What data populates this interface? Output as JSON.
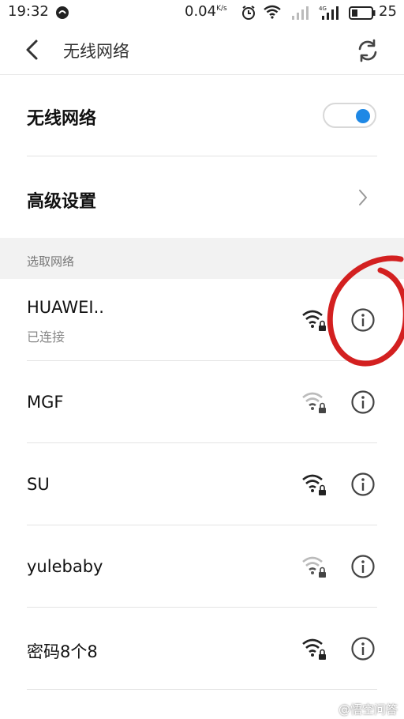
{
  "status_bar": {
    "time": "19:32",
    "speed_value": "0.04",
    "speed_unit": "K/s",
    "network_tag": "4G",
    "battery": "25"
  },
  "header": {
    "title": "无线网络"
  },
  "settings": {
    "wifi_label": "无线网络",
    "wifi_enabled": true,
    "advanced_label": "高级设置"
  },
  "section": {
    "title": "选取网络"
  },
  "networks": [
    {
      "name": "HUAWEI..",
      "status": "已连接",
      "signal": "strong",
      "secured": true
    },
    {
      "name": "MGF",
      "status": "",
      "signal": "weak",
      "secured": true
    },
    {
      "name": "SU",
      "status": "",
      "signal": "strong",
      "secured": true
    },
    {
      "name": "yulebaby",
      "status": "",
      "signal": "weak",
      "secured": true
    },
    {
      "name": "密码8个8",
      "status": "",
      "signal": "strong",
      "secured": true
    }
  ],
  "colors": {
    "accent": "#1e88e5",
    "annotation": "#d32020"
  },
  "watermark": "@悟空问答"
}
